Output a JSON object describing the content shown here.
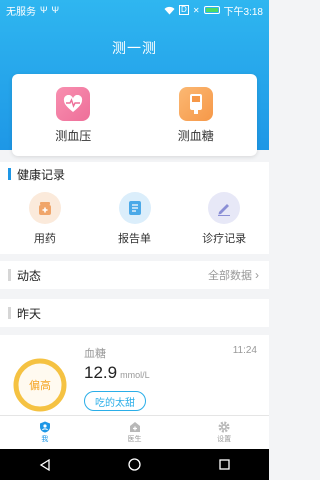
{
  "status_bar": {
    "carrier": "无服务",
    "time": "下午3:18"
  },
  "header": {
    "title": "测一测"
  },
  "measure": {
    "items": [
      {
        "label": "测血压",
        "icon": "heart-pulse-icon",
        "color": "#ee6f99"
      },
      {
        "label": "测血糖",
        "icon": "glucose-meter-icon",
        "color": "#f69848"
      }
    ]
  },
  "health_records": {
    "title": "健康记录",
    "items": [
      {
        "label": "用药",
        "icon": "medicine-box-icon"
      },
      {
        "label": "报告单",
        "icon": "report-icon"
      },
      {
        "label": "诊疗记录",
        "icon": "edit-record-icon"
      }
    ]
  },
  "dynamics": {
    "title": "动态",
    "more": "全部数据"
  },
  "yesterday": {
    "title": "昨天"
  },
  "entry": {
    "status": "偏高",
    "type": "血糖",
    "time": "11:24",
    "value": "12.9",
    "unit": "mmol/L",
    "tag": "吃的太甜",
    "ring_color": "#f5c242"
  },
  "tabbar": {
    "tabs": [
      {
        "label": "我",
        "icon": "person-shield-icon",
        "active": true
      },
      {
        "label": "医生",
        "icon": "medical-house-icon",
        "active": false
      },
      {
        "label": "设置",
        "icon": "gear-icon",
        "active": false
      }
    ]
  },
  "colors": {
    "accent": "#1e97e6",
    "warning": "#f5a524"
  }
}
